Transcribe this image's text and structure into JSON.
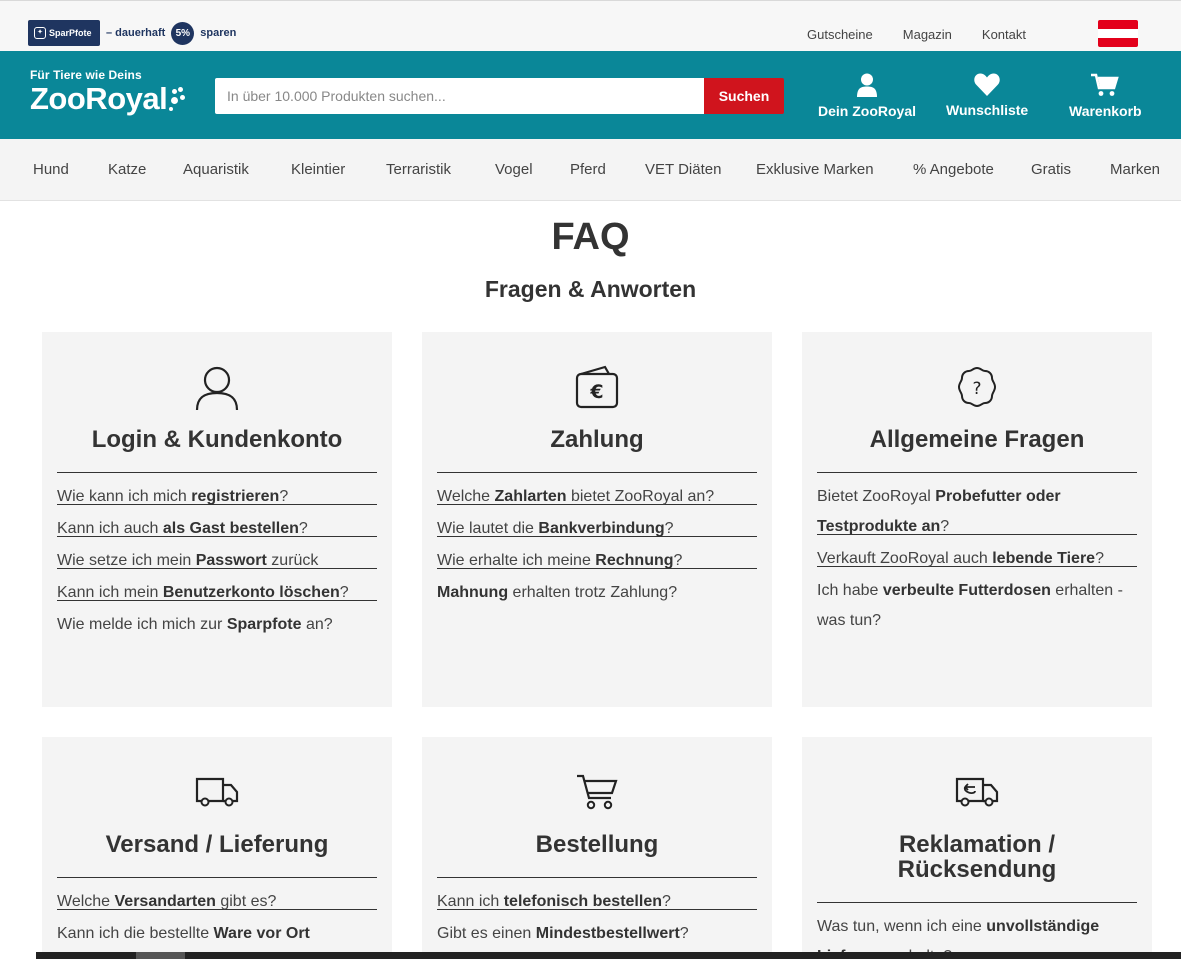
{
  "topbar": {
    "sparpfote_logo": "SparPfote",
    "sparpfote_text": "– dauerhaft",
    "sparpfote_badge": "5%",
    "sparpfote_suffix": "sparen",
    "links": [
      "Gutscheine",
      "Magazin",
      "Kontakt"
    ],
    "flag_colors": [
      "#e3001b",
      "#ffffff",
      "#e3001b"
    ]
  },
  "header": {
    "tagline": "Für Tiere wie Deins",
    "brand": "ZooRoyal",
    "search_placeholder": "In über 10.000 Produkten suchen...",
    "search_button": "Suchen",
    "account_label": "Dein ZooRoyal",
    "wishlist_label": "Wunschliste",
    "cart_label": "Warenkorb",
    "brand_color": "#0a8798",
    "accent_color": "#d0141d"
  },
  "nav": [
    "Hund",
    "Katze",
    "Aquaristik",
    "Kleintier",
    "Terraristik",
    "Vogel",
    "Pferd",
    "VET Diäten",
    "Exklusive Marken",
    "% Angebote",
    "Gratis",
    "Marken"
  ],
  "page": {
    "title": "FAQ",
    "subtitle": "Fragen & Anworten"
  },
  "cards": [
    {
      "icon": "user-icon",
      "title": "Login & Kundenkonto",
      "items": [
        {
          "pre": "Wie kann ich mich ",
          "bold": "registrieren",
          "post": "?"
        },
        {
          "pre": "Kann ich auch ",
          "bold": "als Gast bestellen",
          "post": "?"
        },
        {
          "pre": "Wie setze ich mein ",
          "bold": "Passwort",
          "post": " zurück"
        },
        {
          "pre": "Kann ich mein ",
          "bold": "Benutzerkonto löschen",
          "post": "?"
        },
        {
          "pre": "Wie melde ich mich zur ",
          "bold": "Sparpfote",
          "post": " an?"
        }
      ]
    },
    {
      "icon": "wallet-euro-icon",
      "title": "Zahlung",
      "items": [
        {
          "pre": "Welche ",
          "bold": "Zahlarten",
          "post": " bietet ZooRoyal an?"
        },
        {
          "pre": "Wie lautet die ",
          "bold": "Bankverbindung",
          "post": "?"
        },
        {
          "pre": "Wie erhalte ich meine ",
          "bold": "Rechnung",
          "post": "?"
        },
        {
          "pre": "",
          "bold": "Mahnung",
          "post": " erhalten trotz Zahlung?"
        }
      ]
    },
    {
      "icon": "question-bubble-icon",
      "title": "Allgemeine Fragen",
      "items": [
        {
          "pre": "Bietet ZooRoyal ",
          "bold": "Probefutter oder Testprodukte an",
          "post": "?"
        },
        {
          "pre": "Verkauft ZooRoyal auch ",
          "bold": "lebende Tiere",
          "post": "?"
        },
        {
          "pre": "Ich habe ",
          "bold": "verbeulte Futterdosen",
          "post": " erhalten - was tun?"
        }
      ]
    },
    {
      "icon": "delivery-truck-icon",
      "title": "Versand / Lieferung",
      "items": [
        {
          "pre": "Welche ",
          "bold": "Versandarten",
          "post": " gibt es?"
        },
        {
          "pre": "Kann ich die bestellte ",
          "bold": "Ware vor Ort",
          "post": ""
        }
      ]
    },
    {
      "icon": "shopping-cart-icon",
      "title": "Bestellung",
      "items": [
        {
          "pre": "Kann ich ",
          "bold": "telefonisch bestellen",
          "post": "?"
        },
        {
          "pre": "Gibt es einen ",
          "bold": "Mindestbestellwert",
          "post": "?"
        }
      ]
    },
    {
      "icon": "return-truck-icon",
      "title": "Reklamation / Rücksendung",
      "items": [
        {
          "pre": "Was tun, wenn ich eine ",
          "bold": "unvollständige Lieferung",
          "post": " erhalte?"
        }
      ]
    }
  ]
}
